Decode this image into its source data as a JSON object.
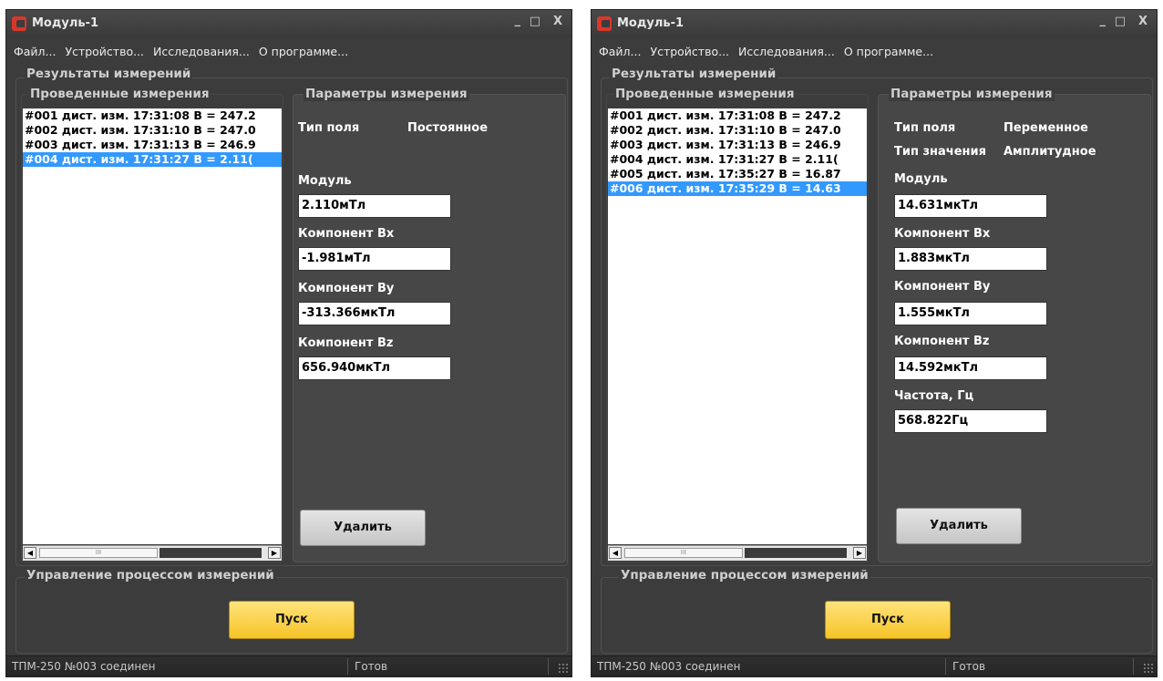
{
  "windows": [
    {
      "title": "Модуль-1",
      "controls": {
        "minimize": "_",
        "maximize": "□",
        "close": "X"
      },
      "menu": [
        "Файл...",
        "Устройство...",
        "Исследования...",
        "О программе..."
      ],
      "results_label": "Результаты измерений",
      "list_label": "Проведенные измерения",
      "params_label": "Параметры измерения",
      "measurements": [
        "#001 дист. изм. 17:31:08 В = 247.2",
        "#002 дист. изм. 17:31:10 В = 247.0",
        "#003 дист. изм. 17:31:13 В = 246.9",
        "#004 дист. изм. 17:31:27 В =   2.11("
      ],
      "selected_index": 3,
      "params": {
        "field_type_label": "Тип поля",
        "field_type_value": "Постоянное",
        "module_label": "Модуль",
        "module_value": "2.110мТл",
        "bx_label": "Компонент Bx",
        "bx_value": "-1.981мТл",
        "by_label": "Компонент By",
        "by_value": "-313.366мкТл",
        "bz_label": "Компонент Bz",
        "bz_value": "656.940мкТл"
      },
      "delete_label": "Удалить",
      "control_label": "Управление процессом измерений",
      "start_label": "Пуск",
      "status": {
        "connection": "ТПМ-250 №003 соединен",
        "state": "Готов"
      },
      "scroll_thumb_glyph": "III"
    },
    {
      "title": "Модуль-1",
      "controls": {
        "minimize": "_",
        "maximize": "□",
        "close": "X"
      },
      "menu": [
        "Файл...",
        "Устройство...",
        "Исследования...",
        "О программе..."
      ],
      "results_label": "Результаты измерений",
      "list_label": "Проведенные измерения",
      "params_label": "Параметры измерения",
      "measurements": [
        "#001 дист. изм. 17:31:08 В = 247.2",
        "#002 дист. изм. 17:31:10 В = 247.0",
        "#003 дист. изм. 17:31:13 В = 246.9",
        "#004 дист. изм. 17:31:27 В =   2.11(",
        "#005 дист. изм. 17:35:27 В = 16.87",
        "#006 дист. изм. 17:35:29 В = 14.63"
      ],
      "selected_index": 5,
      "params": {
        "field_type_label": "Тип поля",
        "field_type_value": "Переменное",
        "value_type_label": "Тип значения",
        "value_type_value": "Амплитудное",
        "module_label": "Модуль",
        "module_value": "14.631мкТл",
        "bx_label": "Компонент Bx",
        "bx_value": "1.883мкТл",
        "by_label": "Компонент By",
        "by_value": "1.555мкТл",
        "bz_label": "Компонент Bz",
        "bz_value": "14.592мкТл",
        "freq_label": "Частота, Гц",
        "freq_value": "568.822Гц"
      },
      "delete_label": "Удалить",
      "control_label": "Управление процессом измерений",
      "start_label": "Пуск",
      "status": {
        "connection": "ТПМ-250 №003 соединен",
        "state": "Готов"
      },
      "scroll_thumb_glyph": "III"
    }
  ]
}
